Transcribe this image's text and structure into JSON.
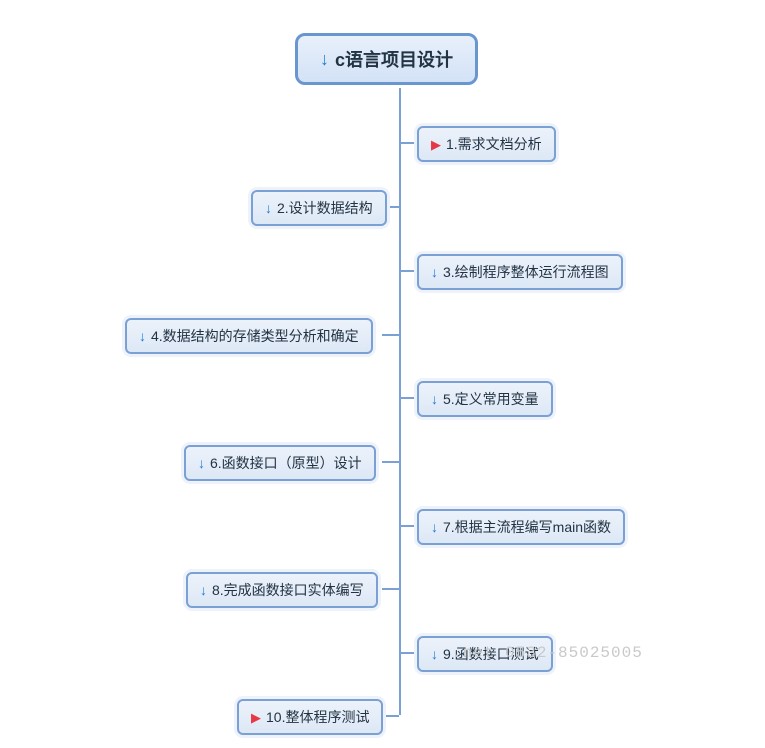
{
  "root": {
    "label": "c语言项目设计",
    "icon": "arrow"
  },
  "nodes": {
    "n1": {
      "label": "1.需求文档分析",
      "icon": "flag"
    },
    "n2": {
      "label": "2.设计数据结构",
      "icon": "arrow"
    },
    "n3": {
      "label": "3.绘制程序整体运行流程图",
      "icon": "arrow"
    },
    "n4": {
      "label": "4.数据结构的存储类型分析和确定",
      "icon": "arrow"
    },
    "n5": {
      "label": "5.定义常用变量",
      "icon": "arrow"
    },
    "n6": {
      "label": "6.函数接口（原型）设计",
      "icon": "arrow"
    },
    "n7": {
      "label": "7.根据主流程编写main函数",
      "icon": "arrow"
    },
    "n8": {
      "label": "8.完成函数接口实体编写",
      "icon": "arrow"
    },
    "n9": {
      "label": "9.函数接口测试",
      "icon": "arrow"
    },
    "n10": {
      "label": "10.整体程序测试",
      "icon": "flag"
    }
  },
  "watermark": {
    "text_partial": ".net 0532-85025005"
  }
}
